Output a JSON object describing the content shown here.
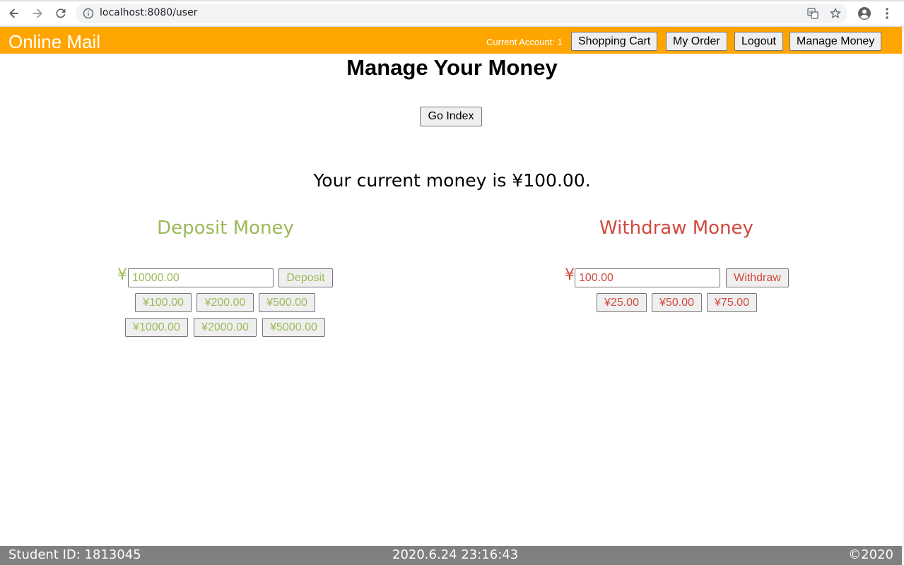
{
  "browser": {
    "url": "localhost:8080/user"
  },
  "header": {
    "brand": "Online Mail",
    "account": "Current Account: 1",
    "buttons": [
      "Shopping Cart",
      "My Order",
      "Logout",
      "Manage Money"
    ]
  },
  "main": {
    "title": "Manage Your Money",
    "go_index": "Go Index",
    "balance": "Your current money is ¥100.00."
  },
  "deposit": {
    "title": "Deposit Money",
    "currency": "¥",
    "value": "10000.00",
    "action": "Deposit",
    "quick_amounts": [
      "¥100.00",
      "¥200.00",
      "¥500.00",
      "¥1000.00",
      "¥2000.00",
      "¥5000.00"
    ],
    "color": "#9bbb59"
  },
  "withdraw": {
    "title": "Withdraw Money",
    "currency": "¥",
    "value": "100.00",
    "action": "Withdraw",
    "quick_amounts": [
      "¥25.00",
      "¥50.00",
      "¥75.00"
    ],
    "color": "#d04a3f"
  },
  "footer": {
    "student_id": "Student ID: 1813045",
    "datetime": "2020.6.24 23:16:43",
    "copyright": "©2020"
  },
  "colors": {
    "header_bg": "#ffa500",
    "footer_bg": "#808080"
  }
}
